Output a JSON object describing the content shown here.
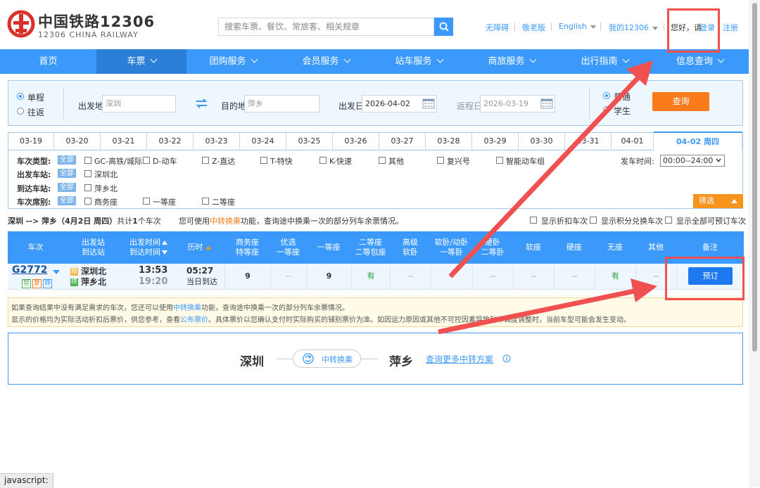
{
  "header": {
    "logo_cn": "中国铁路12306",
    "logo_en": "12306 CHINA RAILWAY",
    "search_placeholder": "搜索车票、餐饮、常旅客、相关规章",
    "links": {
      "accessible": "无障碍",
      "elder": "敬老版",
      "english": "English",
      "my12306": "我的12306",
      "greeting": "您好，请",
      "login": "登录",
      "register": "注册"
    }
  },
  "nav": {
    "items": [
      "首页",
      "车票",
      "团购服务",
      "会员服务",
      "站车服务",
      "商旅服务",
      "出行指南",
      "信息查询"
    ]
  },
  "query": {
    "trip_type": {
      "oneway": "单程",
      "roundtrip": "往返"
    },
    "from_label": "出发地",
    "from_value": "深圳",
    "to_label": "目的地",
    "to_value": "萍乡",
    "depart_label": "出发日",
    "depart_value": "2026-04-02",
    "return_label": "返程日",
    "return_value": "2026-03-19",
    "passenger": {
      "normal": "普通",
      "student": "学生"
    },
    "submit": "查询"
  },
  "dates": [
    {
      "label": "03-19"
    },
    {
      "label": "03-20"
    },
    {
      "label": "03-21"
    },
    {
      "label": "03-22"
    },
    {
      "label": "03-23"
    },
    {
      "label": "03-24"
    },
    {
      "label": "03-25"
    },
    {
      "label": "03-26"
    },
    {
      "label": "03-27"
    },
    {
      "label": "03-28"
    },
    {
      "label": "03-29"
    },
    {
      "label": "03-30"
    },
    {
      "label": "03-31"
    },
    {
      "label": "04-01"
    },
    {
      "label": "04-02 周四",
      "selected": true
    }
  ],
  "filters": {
    "train_type_label": "车次类型:",
    "all": "全部",
    "train_types": [
      "GC-高铁/城际",
      "D-动车",
      "Z-直达",
      "T-特快",
      "K-快速",
      "其他",
      "复兴号",
      "智能动车组"
    ],
    "depart_time_label": "发车时间:",
    "depart_time_value": "00:00--24:00",
    "depart_station_label": "出发车站:",
    "depart_stations": [
      "深圳北"
    ],
    "arrive_station_label": "到达车站:",
    "arrive_stations": [
      "萍乡北"
    ],
    "seat_label": "车次席别:",
    "seats": [
      "商务座",
      "一等座",
      "二等座"
    ],
    "filter_button": "筛选"
  },
  "summary": {
    "route": "深圳 --> 萍乡（4月2日 周四）",
    "count_prefix": "共计",
    "count": "1",
    "count_suffix": "个车次",
    "tip_prefix": "您可使用",
    "tip_link": "中转换乘",
    "tip_suffix": "功能，查询途中换乘一次的部分列车余票情况。",
    "opt1": "显示折扣车次",
    "opt2": "显示积分兑换车次",
    "opt3": "显示全部可预订车次"
  },
  "table": {
    "headers": {
      "train": "车次",
      "station_1": "出发站",
      "station_2": "到达站",
      "time_1": "出发时间",
      "time_2": "到达时间",
      "duration": "历时",
      "business_1": "商务座",
      "business_2": "特等座",
      "premium_1": "优选",
      "premium_2": "一等座",
      "first": "一等座",
      "second_1": "二等座",
      "second_2": "二等包座",
      "soft_adv_1": "高级",
      "soft_adv_2": "软卧",
      "soft_1": "软卧/动卧",
      "soft_2": "一等卧",
      "hard_1": "硬卧",
      "hard_2": "二等卧",
      "soft_seat": "软座",
      "hard_seat": "硬座",
      "no_seat": "无座",
      "other": "其他",
      "remark": "备注"
    },
    "row": {
      "train_no": "G2772",
      "badges": [
        "智",
        "复",
        "静"
      ],
      "from_tag": "始",
      "from": "深圳北",
      "to_tag": "终",
      "to": "萍乡北",
      "depart": "13:53",
      "arrive": "19:20",
      "duration": "05:27",
      "arrival_day": "当日到达",
      "business": "9",
      "premium": "--",
      "first": "9",
      "second": "有",
      "soft_adv": "--",
      "soft": "--",
      "hard": "--",
      "soft_seat": "--",
      "hard_seat": "--",
      "no_seat": "有",
      "other": "--",
      "book": "预订"
    }
  },
  "notice": {
    "line1_prefix": "如果查询结果中没有满足需求的车次，您还可以使用",
    "line1_link": "中转换乘",
    "line1_suffix": "功能，查询途中换乘一次的部分列车余票情况。",
    "line2_prefix": "显示的价格均为实际活动折扣后票价，供您参考，查看",
    "line2_link": "公布票价",
    "line2_suffix": "。具体票价以您确认支付时实际购买的铺别票价为准。如因运力原因或其他不可控因素导致列车调度调整时，当前车型可能会发生变动。"
  },
  "transfer": {
    "from": "深圳",
    "button": "中转换乘",
    "to": "萍乡",
    "more": "查询更多中转方案"
  },
  "statusbar": "javascript:",
  "colors": {
    "primary": "#3b99fc",
    "orange": "#f97b1c",
    "annotation": "#f05050"
  }
}
